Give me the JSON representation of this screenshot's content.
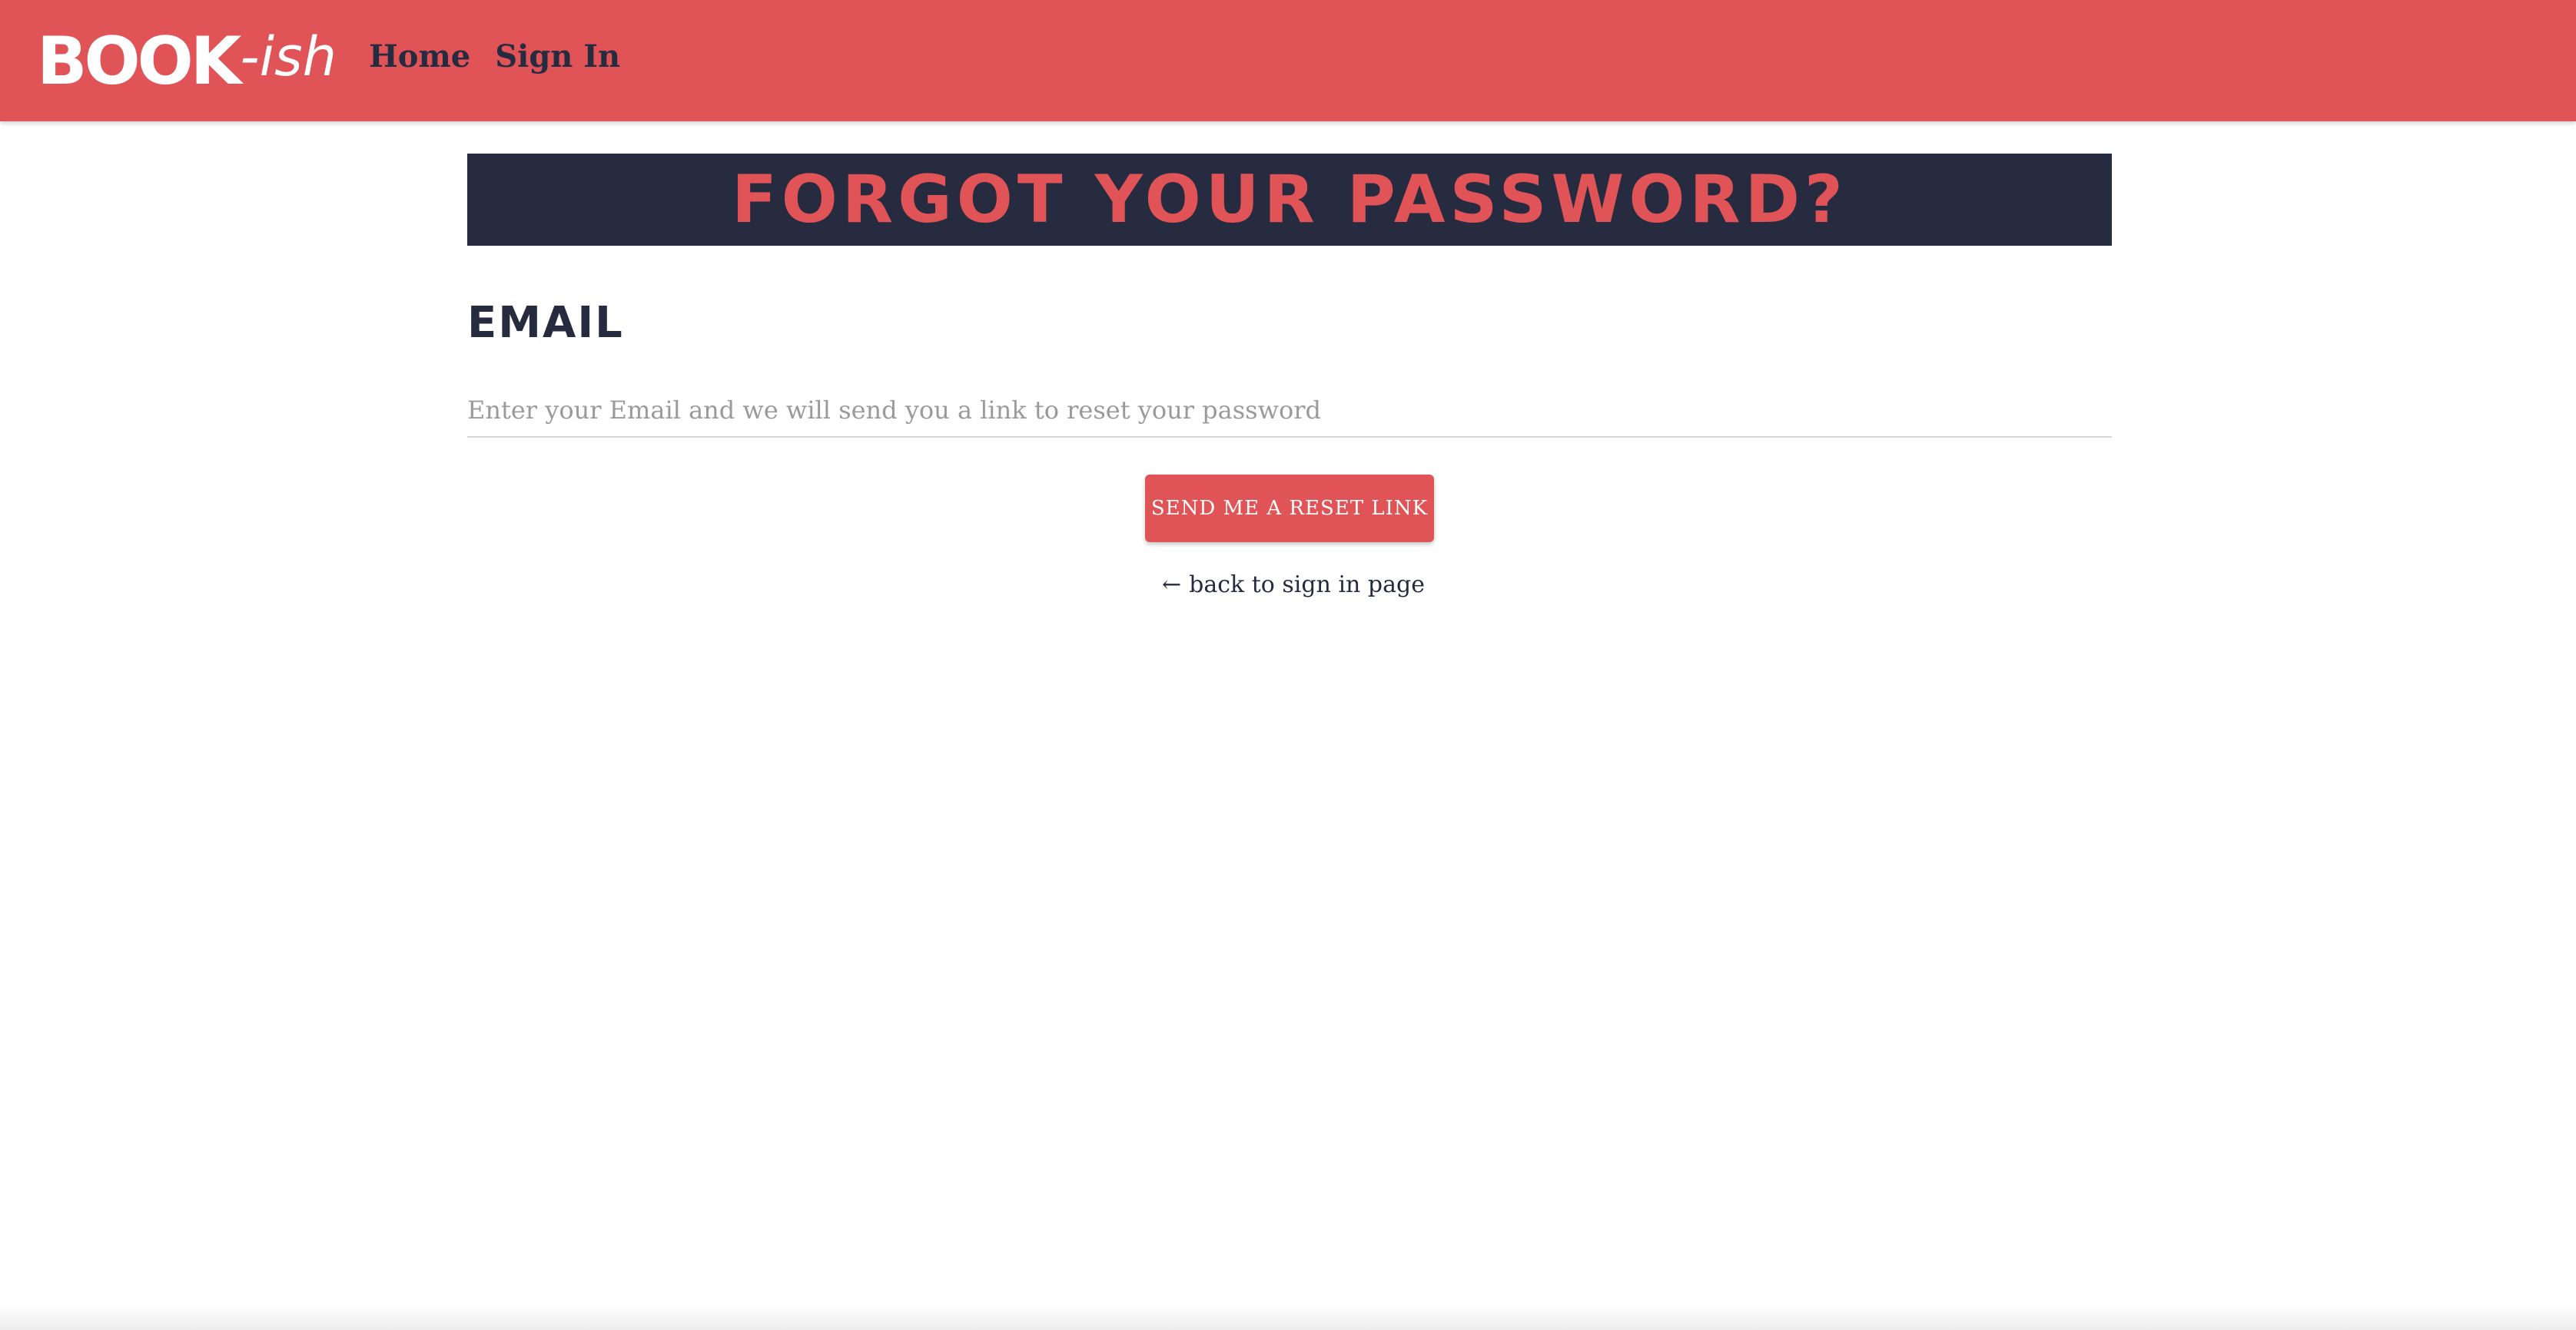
{
  "navbar": {
    "logo_main": "BOOK",
    "logo_suffix": "-ish",
    "links": [
      {
        "label": "Home"
      },
      {
        "label": "Sign In"
      }
    ],
    "background_color": "#e05356"
  },
  "page": {
    "title": "FORGOT YOUR PASSWORD?",
    "email_label": "EMAIL",
    "email_input": {
      "value": "",
      "placeholder": "Enter your Email and we will send you a link to reset your password"
    },
    "submit_label": "SEND ME A RESET LINK",
    "back_link": {
      "arrow": "←",
      "label": "back to sign in page"
    }
  },
  "colors": {
    "accent": "#e05356",
    "dark": "#262b40"
  }
}
